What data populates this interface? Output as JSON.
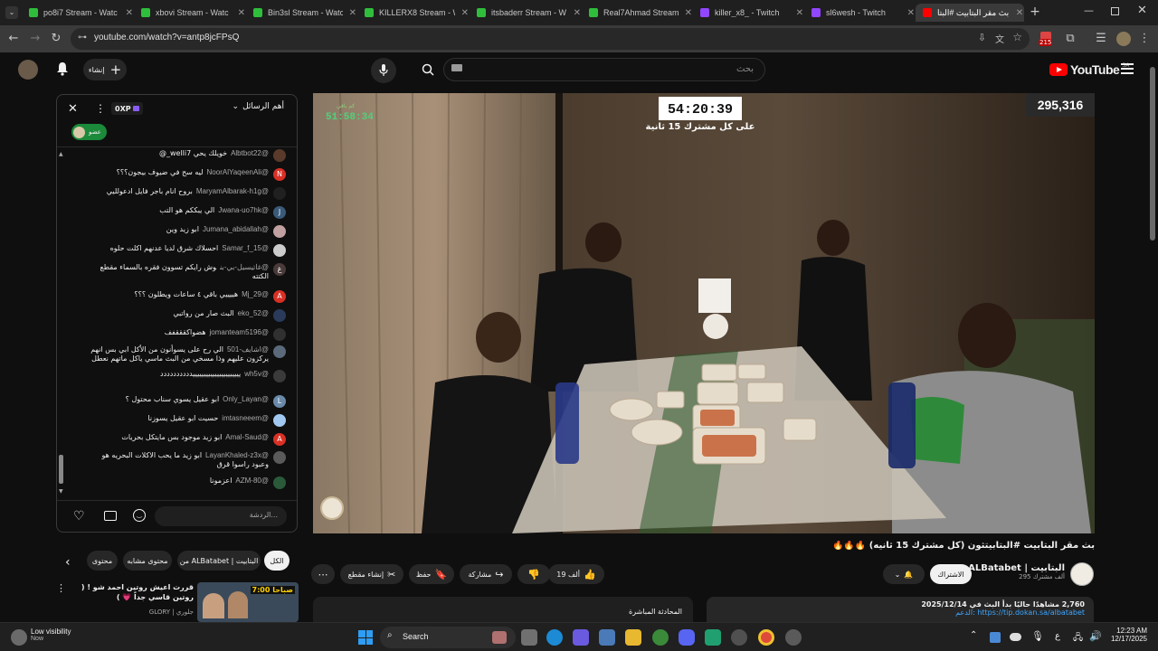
{
  "tabs": [
    {
      "title": "po8i7 Stream - Watc",
      "color": "#2fbe3c"
    },
    {
      "title": "xbovi Stream - Watc",
      "color": "#2fbe3c"
    },
    {
      "title": "Bin3sl Stream - Watc",
      "color": "#2fbe3c"
    },
    {
      "title": "KILLERX8 Stream - W",
      "color": "#2fbe3c"
    },
    {
      "title": "itsbaderr Stream - W",
      "color": "#2fbe3c"
    },
    {
      "title": "Real7Ahmad Stream",
      "color": "#2fbe3c"
    },
    {
      "title": "killer_x8_ - Twitch",
      "color": "#9146ff"
    },
    {
      "title": "sl6wesh - Twitch",
      "color": "#9146ff"
    },
    {
      "title": "بث مقر البتابيت #البتا",
      "color": "#ff0000"
    }
  ],
  "url": "youtube.com/watch?v=antp8jcFPsQ",
  "extension_badge": "215",
  "yt": {
    "create_label": "إنشاء",
    "search_placeholder": "بحث",
    "logo_text": "YouTube",
    "region": "SA"
  },
  "chat": {
    "header_label": "أهم الرسائل",
    "points_badge": "0XP",
    "member_chip": "عضو",
    "input_placeholder": "الردشة...",
    "messages": [
      {
        "user": "@Albtbot22",
        "text": "خويلك يحي welli7_@",
        "avatar": "#5a3a2a",
        "initial": ""
      },
      {
        "user": "@NoorAlYaqeenAli",
        "text": "ليه سح في ضيوف بيجون؟؟؟",
        "avatar": "#d93025",
        "initial": "N"
      },
      {
        "user": "@MaryamAlbarak-h1g",
        "text": "بروح انام باجر فايل ادعولليي",
        "avatar": "#202020",
        "initial": ""
      },
      {
        "user": "@Jwana-uo7hk",
        "text": "الي يبككم هو التب",
        "avatar": "#3a5a7a",
        "initial": "J"
      },
      {
        "user": "@Jumana_abidallah",
        "text": "ابو زيد وين",
        "avatar": "#c0a0a0",
        "initial": ""
      },
      {
        "user": "@Samar_f_15",
        "text": "احسلاك شرق لديا عدنهم اكلت حلوه",
        "avatar": "#cccccc",
        "initial": ""
      },
      {
        "user": "@غاتيسيل-بي-بن",
        "text": "وش رايكم تسوون فقره بالسماء مقطع الكتته",
        "avatar": "#4a3a3a",
        "initial": "غ"
      },
      {
        "user": "@Mj_29",
        "text": "هييييي باقي ٤ ساعات ويطلون ؟؟؟",
        "avatar": "#d93025",
        "initial": "A"
      },
      {
        "user": "@eko_52",
        "text": "البث صار من رواتبي",
        "avatar": "#2a3a5a",
        "initial": ""
      },
      {
        "user": "@jomanteam5196",
        "text": "هضواكقققفف",
        "avatar": "#303030",
        "initial": ""
      },
      {
        "user": "@اشايف-501",
        "text": "الي رح على يسوأنون من الأكل ابي بس انهم يركزون عليهم وذا مسخي من البث ماسي ياكل ماتهم نعطل",
        "avatar": "#5a6a7a",
        "initial": ""
      },
      {
        "user": "@wh5v",
        "text": "ييييييييييييييييييييييدددددددددد",
        "avatar": "#3a3a3a",
        "initial": ""
      },
      {
        "user": "@Only_Layan",
        "text": "ابو عقيل يسوي سناب محتول ؟",
        "avatar": "#6a8aaa",
        "initial": "L"
      },
      {
        "user": "@imtasneeem",
        "text": "حسيت ابو عقيل يسوزنا",
        "avatar": "#a0c8f0",
        "initial": ""
      },
      {
        "user": "@Amal-Saud",
        "text": "ابو زيد موجود بس مايتكل بحريات",
        "avatar": "#d93025",
        "initial": "A"
      },
      {
        "user": "@LayanKhaled-z3x",
        "text": "ابو زيد ما يحب الاكلات البحريه هو وعبود راسوا قرق",
        "avatar": "#5a5a5a",
        "initial": ""
      },
      {
        "user": "@AZM-80",
        "text": "اعزمونا",
        "avatar": "#2a5a3a",
        "initial": ""
      }
    ]
  },
  "video": {
    "viewer_count": "295,316",
    "countdown": "54:20:39",
    "countdown_caption": "على كل مشترك 15 ثانية",
    "elapsed_label": "كم باقي",
    "elapsed": "51:58:34"
  },
  "below": {
    "title": "بث مقر البتابيت #البتابيتثون (كل مشترك 15 ثانيه) 🔥🔥🔥",
    "channel": "ALBatabet | البتابيت",
    "subscribers": "295 ألف مشترك",
    "subscribed_label": "الاشتراك",
    "likes": "19 ألف",
    "share_label": "مشاركة",
    "save_label": "حفظ",
    "clip_label": "إنشاء مقطع",
    "more_icon": "more-icon",
    "chips": [
      "الكل",
      "من ALBatabet | البتابيت",
      "محتوى مشابه",
      "محتوى"
    ],
    "live_chat_label": "المحادثة المباشرة",
    "desc_line1": "2,760 مشاهدًا حاليًا بدأ البث في 2025/12/14",
    "desc_line2": "https://tip.dokan.sa/albatabet :الدعم"
  },
  "suggestion": {
    "title": "قررت اعيش روتين احمد شو ! ( روتين قاسي جداً 💗 )",
    "channel": "GLORY | جلوري",
    "thumb_text": "7:00 صباحا"
  },
  "taskbar": {
    "weather_title": "Low visibility",
    "weather_sub": "Now",
    "search_label": "Search",
    "language": "ع",
    "time": "12:23 AM",
    "date": "12/17/2025"
  }
}
